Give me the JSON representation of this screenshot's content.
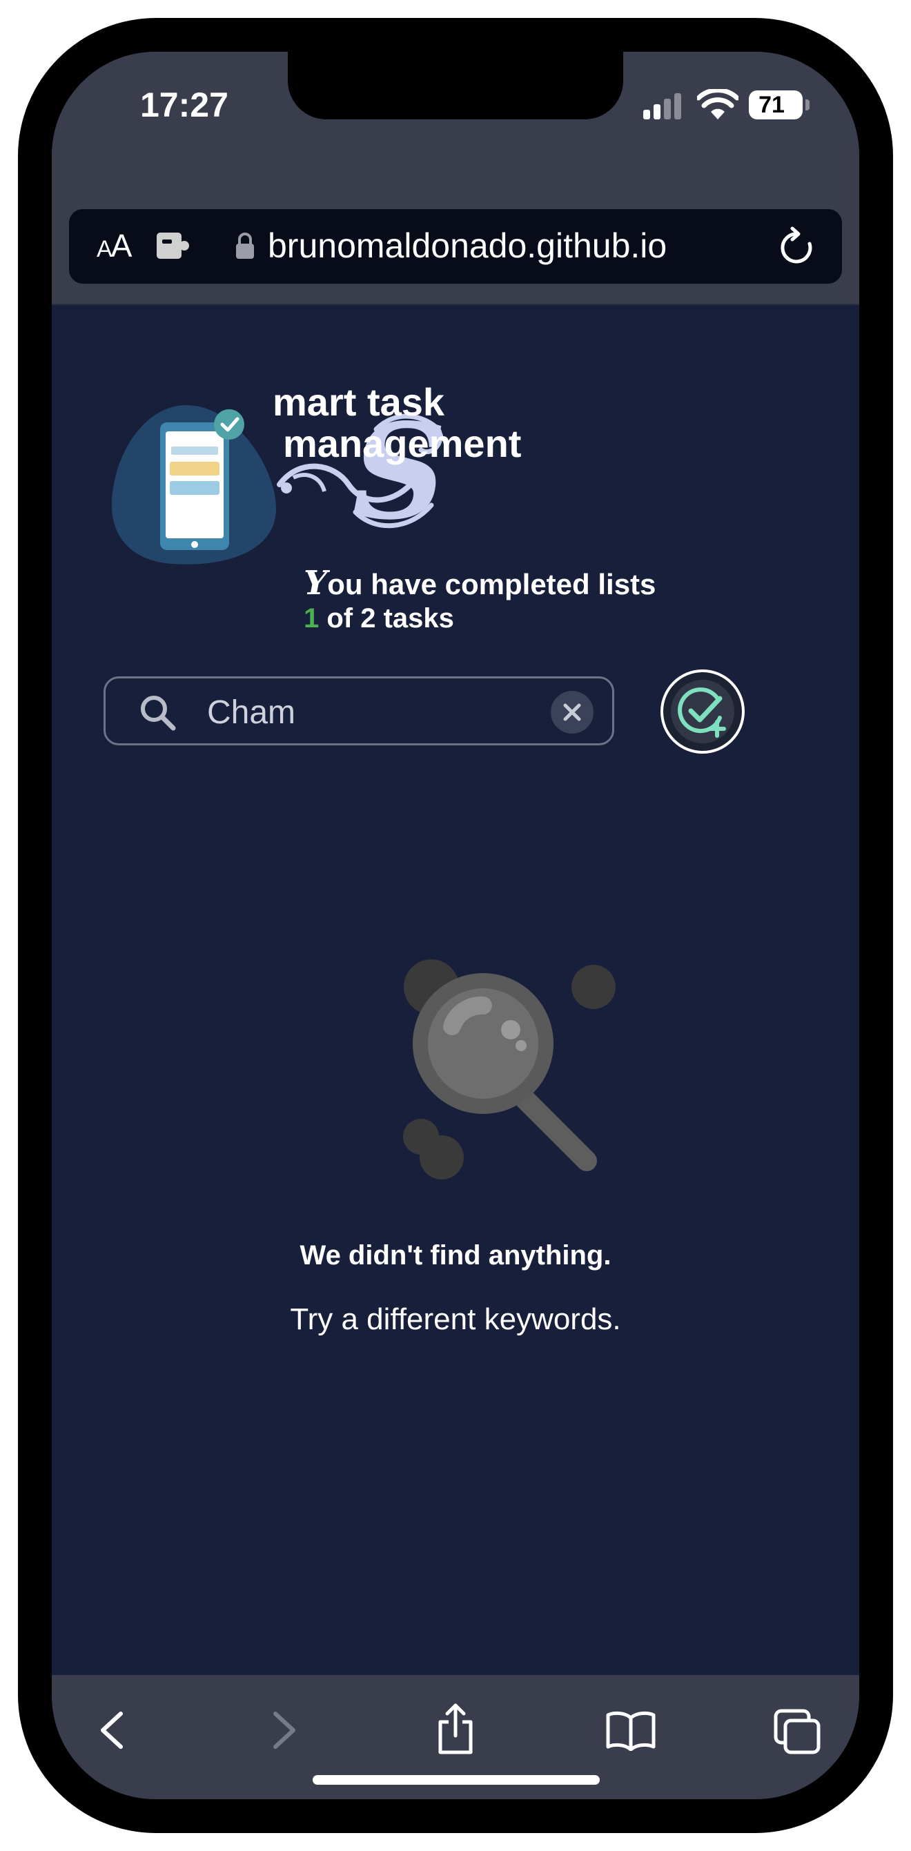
{
  "status_bar": {
    "time": "17:27",
    "battery": "71"
  },
  "browser": {
    "text_size_label_small": "A",
    "text_size_label_large": "A",
    "url": "brunomaldonado.github.io"
  },
  "header": {
    "title_initial": "S",
    "title_line1": "mart task",
    "title_line2": "management",
    "progress_initial": "Y",
    "progress_text": "ou have completed lists",
    "completed_count": "1",
    "total_text": "of 2 tasks"
  },
  "search": {
    "value": "Cham",
    "placeholder": ""
  },
  "empty_state": {
    "title": "We didn't find anything.",
    "subtitle": "Try a different keywords."
  },
  "colors": {
    "background": "#181f3b",
    "chrome": "#3a3d4c",
    "accent_green": "#4caf50",
    "add_button_icon": "#7fe0c0"
  }
}
